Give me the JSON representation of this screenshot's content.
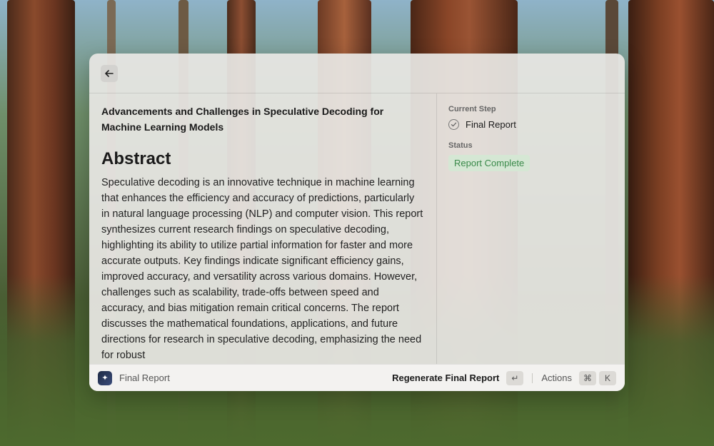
{
  "document": {
    "title": "Advancements and Challenges in Speculative Decoding for Machine Learning Models",
    "section_heading": "Abstract",
    "abstract": "Speculative decoding is an innovative technique in machine learning that enhances the efficiency and accuracy of predictions, particularly in natural language processing (NLP) and computer vision. This report synthesizes current research findings on speculative decoding, highlighting its ability to utilize partial information for faster and more accurate outputs. Key findings indicate significant efficiency gains, improved accuracy, and versatility across various domains. However, challenges such as scalability, trade-offs between speed and accuracy, and bias mitigation remain critical concerns. The report discusses the mathematical foundations, applications, and future directions for research in speculative decoding, emphasizing the need for robust"
  },
  "sidebar": {
    "current_step_label": "Current Step",
    "current_step_value": "Final Report",
    "status_label": "Status",
    "status_value": "Report Complete"
  },
  "footer": {
    "title": "Final Report",
    "primary_action": "Regenerate Final Report",
    "primary_shortcut": "↵",
    "actions_label": "Actions",
    "actions_shortcut_mod": "⌘",
    "actions_shortcut_key": "K"
  },
  "colors": {
    "status_badge_bg": "#d5e7d4",
    "status_badge_text": "#3a8a4a"
  }
}
